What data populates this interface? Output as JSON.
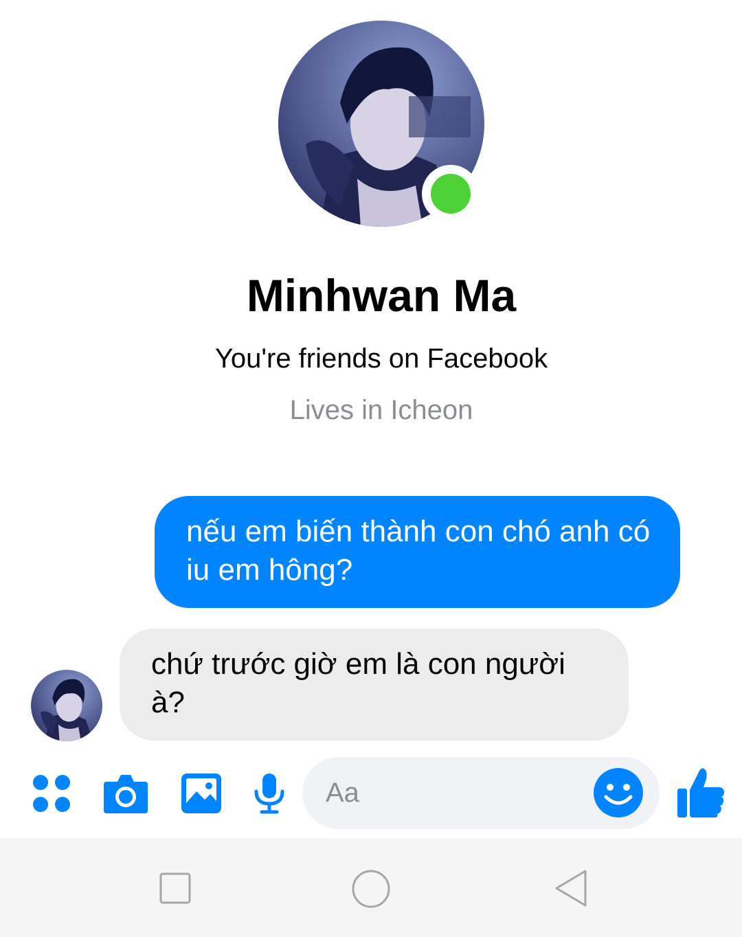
{
  "colors": {
    "accent": "#0084ff",
    "online": "#4cd137",
    "incoming_bubble": "#ececec",
    "nav_icon": "#a6a6a6"
  },
  "profile": {
    "name": "Minhwan Ma",
    "friend_status": "You're friends on Facebook",
    "lives_in": "Lives in Icheon"
  },
  "messages": {
    "outgoing": "nếu em biến thành con chó anh có iu em hông?",
    "incoming": "chứ trước giờ em là con người à?"
  },
  "composer": {
    "placeholder": "Aa",
    "tools": [
      "apps-icon",
      "camera-icon",
      "image-icon",
      "microphone-icon"
    ]
  },
  "nav": {
    "icons": [
      "recent-apps-icon",
      "home-icon",
      "back-icon"
    ]
  }
}
